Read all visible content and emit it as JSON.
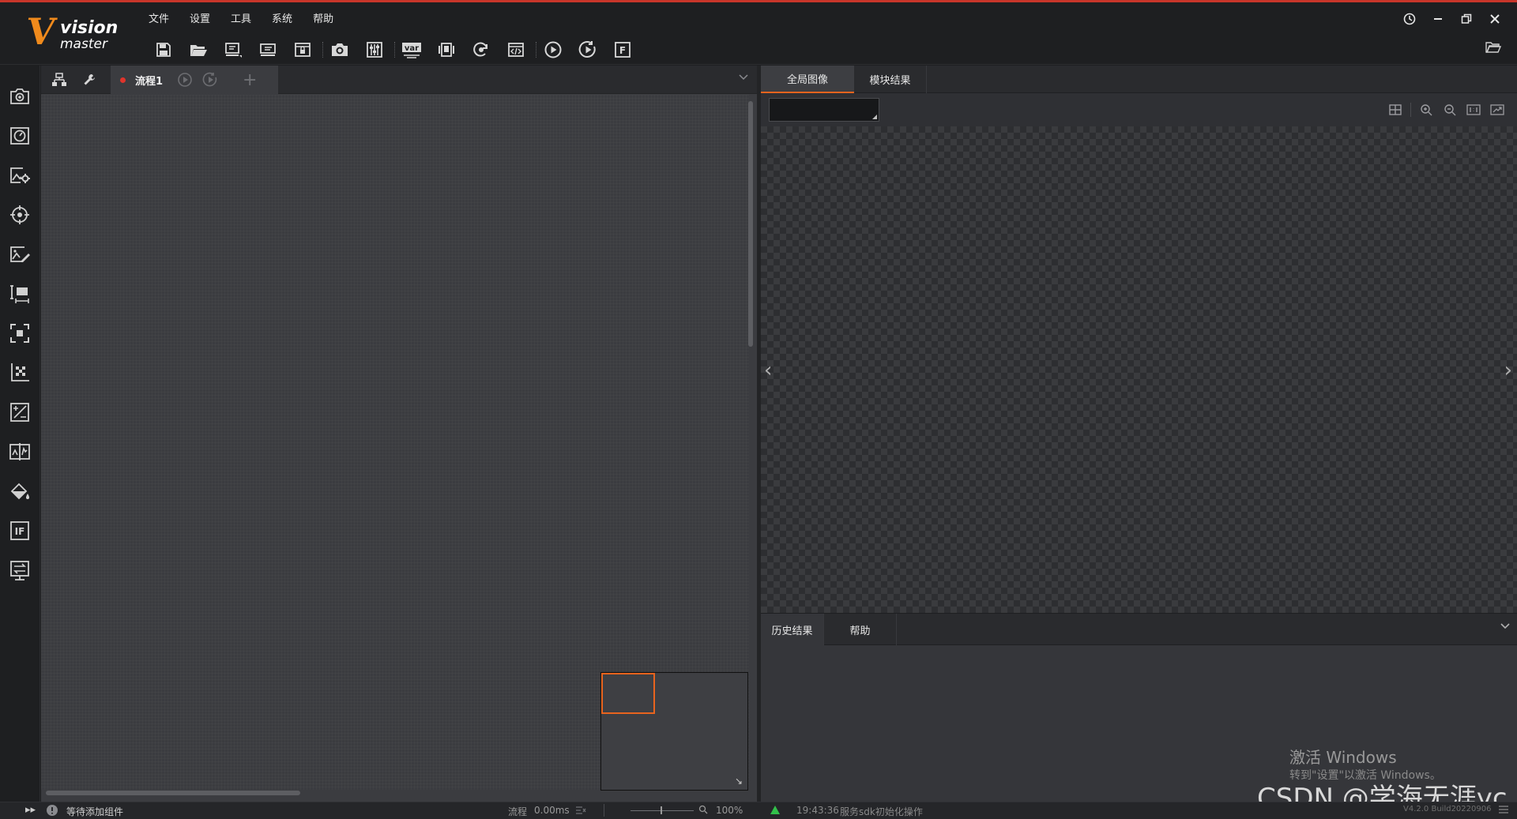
{
  "app": {
    "logo_main": "vision",
    "logo_sub": "master",
    "logo_letter": "V",
    "accent_color": "#e8641e"
  },
  "menu": {
    "items": [
      {
        "label": "文件"
      },
      {
        "label": "设置"
      },
      {
        "label": "工具"
      },
      {
        "label": "系统"
      },
      {
        "label": "帮助"
      }
    ]
  },
  "toolbar": {
    "icons": [
      "save-icon",
      "open-folder-icon",
      "save-as-icon",
      "import-icon",
      "lock-icon",
      "camera-icon",
      "controller-icon",
      "variable-icon",
      "communication-icon",
      "global-trigger-icon",
      "script-icon",
      "run-once-icon",
      "run-loop-icon",
      "global-f-icon"
    ],
    "var_label": "var",
    "f_label": "F"
  },
  "window_controls": [
    "history-clock-icon",
    "minimize-icon",
    "restore-icon",
    "close-icon"
  ],
  "left_toolbox": {
    "icons": [
      "image-source-icon",
      "calibration-icon",
      "image-processing-icon",
      "positioning-icon",
      "image-edit-icon",
      "measurement-icon",
      "recognition-icon",
      "calibration-grid-icon",
      "logic-calc-icon",
      "contrast-icon",
      "color-processing-icon",
      "if-logic-icon",
      "communication-io-icon"
    ],
    "if_label": "IF"
  },
  "flow": {
    "tab_label": "流程1",
    "add_label": "+",
    "status_text": "等待添加组件",
    "time_label": "流程",
    "time_value": "0.00ms",
    "zoom": "100%"
  },
  "image_panel": {
    "tabs": [
      "全局图像",
      "模块结果"
    ],
    "active_tab": "全局图像",
    "prev_arrow": "‹",
    "next_arrow": "›"
  },
  "history_panel": {
    "tabs": [
      "历史结果",
      "帮助"
    ],
    "active_tab": "历史结果"
  },
  "log": {
    "time": "19:43:36",
    "message": "服务sdk初始化操作"
  },
  "overlay": {
    "activation_title": "激活 Windows",
    "activation_sub": "转到\"设置\"以激活 Windows。",
    "csdn": "CSDN @学海无涯yc",
    "build": "V4.2.0 Build20220906"
  }
}
